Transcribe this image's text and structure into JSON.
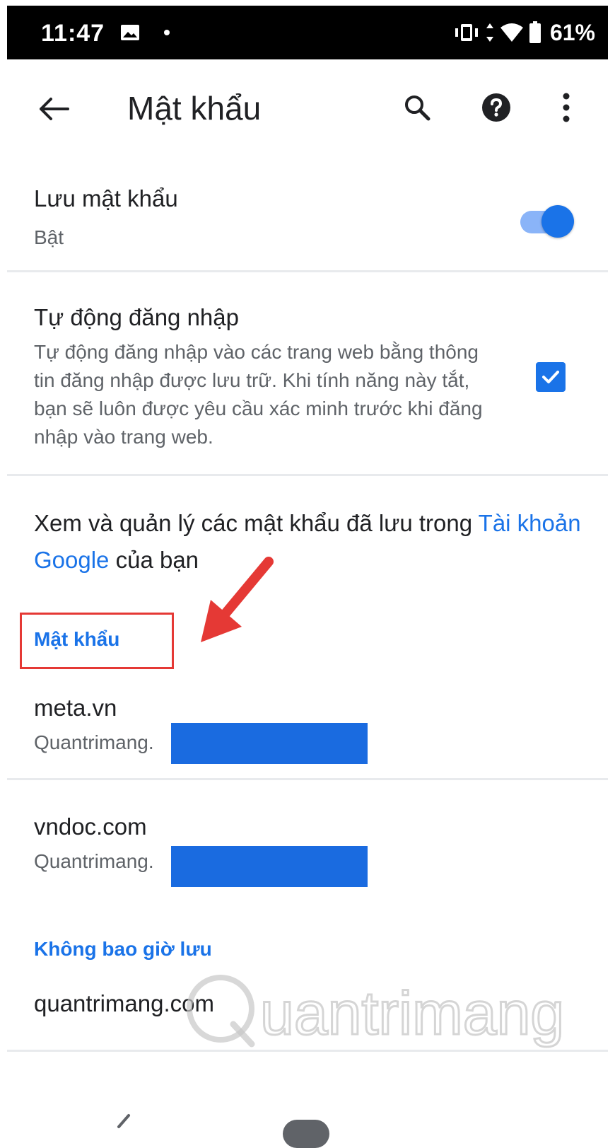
{
  "status_bar": {
    "time": "11:47",
    "battery": "61%"
  },
  "app_bar": {
    "title": "Mật khẩu"
  },
  "save_passwords": {
    "title": "Lưu mật khẩu",
    "status": "Bật",
    "enabled": true
  },
  "auto_signin": {
    "title": "Tự động đăng nhập",
    "description": "Tự động đăng nhập vào các trang web bằng thông tin đăng nhập được lưu trữ. Khi tính năng này tắt, bạn sẽ luôn được yêu cầu xác minh trước khi đăng nhập vào trang web.",
    "checked": true
  },
  "manage": {
    "text_before": "Xem và quản lý các mật khẩu đã lưu trong ",
    "link": "Tài khoản Google",
    "text_after": " của bạn"
  },
  "passwords_section": {
    "header": "Mật khẩu",
    "entries": [
      {
        "site": "meta.vn",
        "username": "Quantrimang."
      },
      {
        "site": "vndoc.com",
        "username": "Quantrimang."
      }
    ]
  },
  "never_saved_section": {
    "header": "Không bao giờ lưu",
    "entries": [
      "quantrimang.com"
    ]
  },
  "watermark": "uantrimang",
  "colors": {
    "accent": "#1a73e8",
    "highlight": "#e53935"
  }
}
